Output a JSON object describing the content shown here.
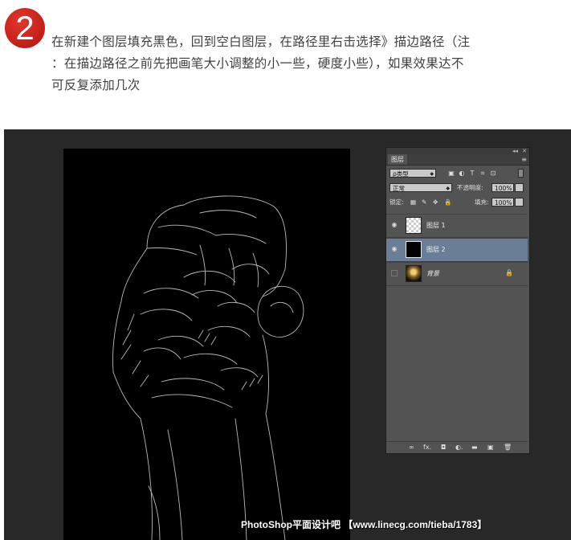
{
  "step": {
    "number": "2",
    "color": "#c41e16"
  },
  "instructions": {
    "line1": "在新建个图层填充黑色，回到空白图层，在路径里右击选择》描边路径（注",
    "line2": "：在描边路径之前先把画笔大小调整的小一些，硬度小些），如果效果达不",
    "line3": "可反复添加几次"
  },
  "layers_panel": {
    "top_controls": {
      "collapse": "◂◂",
      "close": "✕"
    },
    "tab_label": "图层",
    "tab_menu_icon": "menu-icon",
    "filter_kind": "ρ类型",
    "filter_icons": [
      "image-filter-icon",
      "adjustment-filter-icon",
      "type-filter-icon",
      "shape-filter-icon",
      "smart-object-filter-icon"
    ],
    "blend_mode": "正常",
    "opacity_label": "不透明度:",
    "opacity_value": "100%",
    "lock_label": "锁定:",
    "lock_icons": [
      "lock-transparent-icon",
      "lock-paint-icon",
      "lock-move-icon",
      "lock-all-icon"
    ],
    "fill_label": "填充:",
    "fill_value": "100%",
    "layers": [
      {
        "name": "图层 1",
        "visible": true,
        "selected": false,
        "thumbnail": "transparent"
      },
      {
        "name": "图层 2",
        "visible": true,
        "selected": true,
        "thumbnail": "black"
      },
      {
        "name": "背景",
        "visible": false,
        "selected": false,
        "thumbnail": "photo",
        "locked": true
      }
    ],
    "bottom_icons": [
      "link-icon",
      "fx-icon",
      "mask-icon",
      "adjustment-icon",
      "folder-icon",
      "new-layer-icon",
      "trash-icon"
    ],
    "bottom_labels": {
      "link": "∞",
      "fx": "fx.",
      "mask": "◘",
      "adjustment": "◐.",
      "folder": "▬",
      "new": "▣",
      "trash": "🗑"
    }
  },
  "watermark": "PhotoShop平面设计吧 【www.linecg.com/tieba/1783】",
  "colors": {
    "workspace": "#282828",
    "panel": "#535353",
    "selected_layer": "#6a7e96",
    "canvas": "#000000",
    "stroke": "#cfcfcf"
  }
}
